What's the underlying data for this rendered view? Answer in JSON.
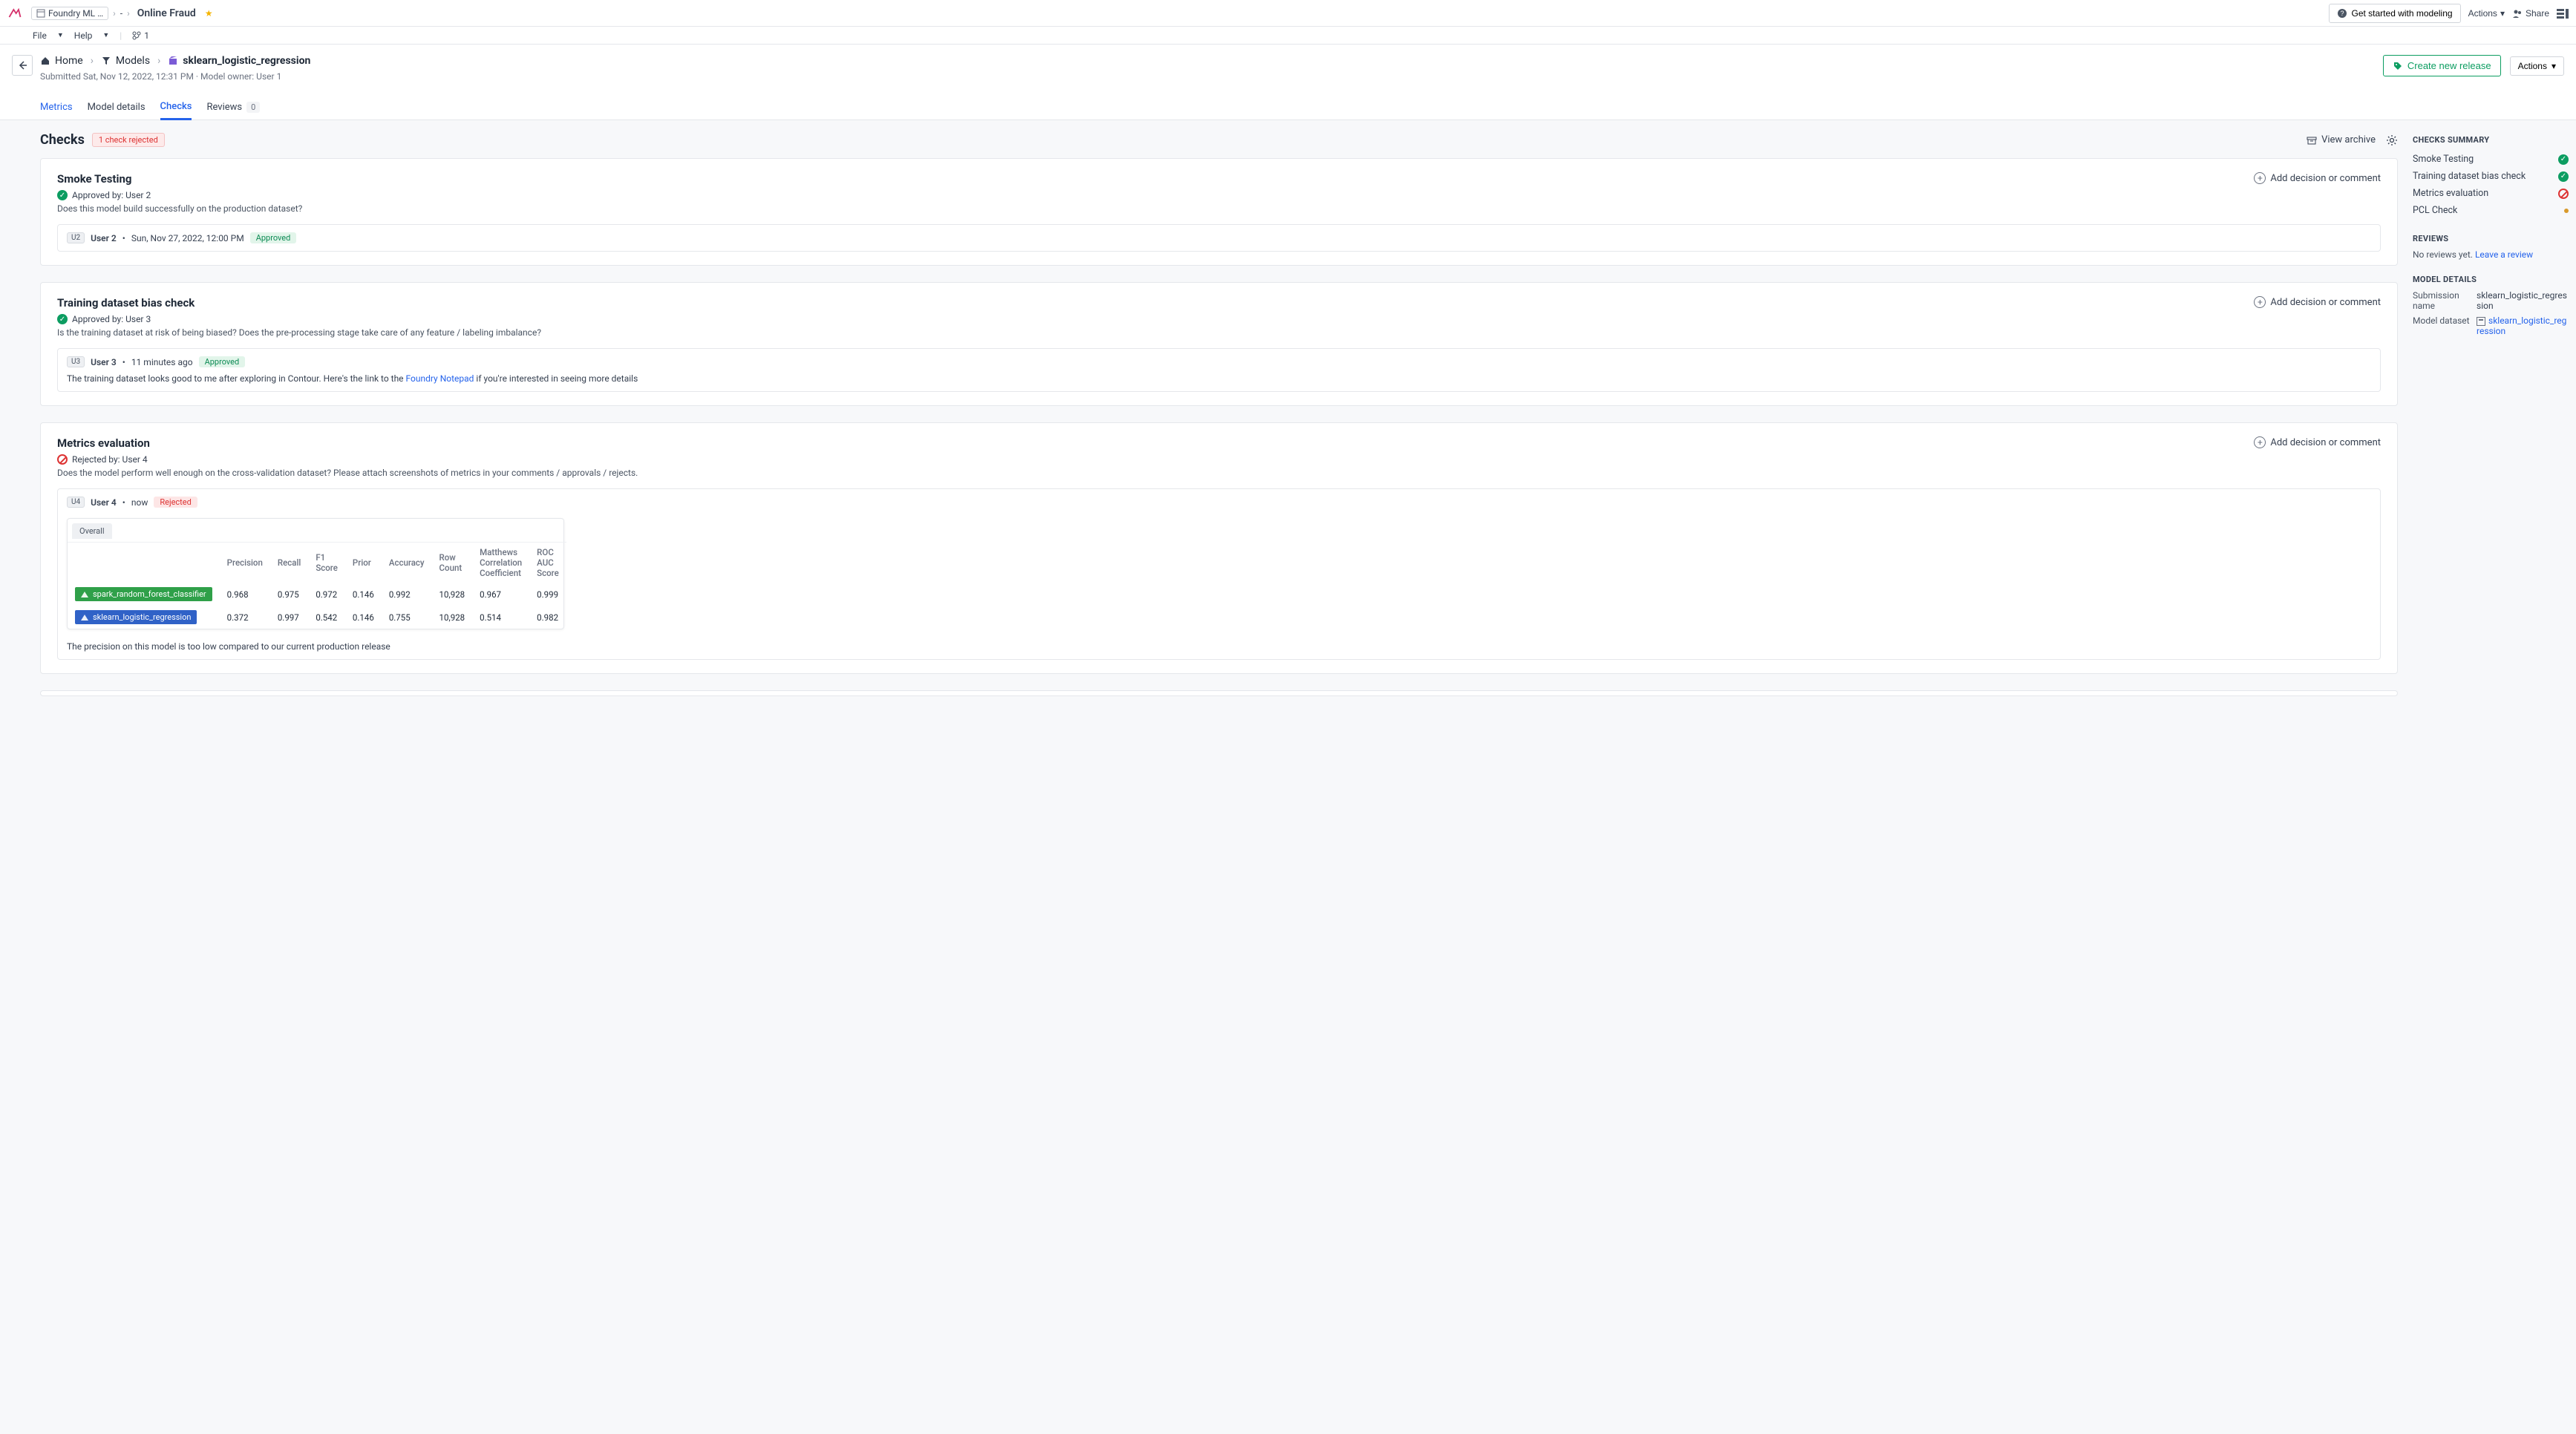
{
  "topbar": {
    "project": "Foundry ML …",
    "separator": "-",
    "title": "Online Fraud",
    "getStarted": "Get started with modeling",
    "actions": "Actions",
    "share": "Share"
  },
  "menubar": {
    "file": "File",
    "help": "Help",
    "branchCount": "1"
  },
  "breadcrumbs": {
    "home": "Home",
    "models": "Models",
    "current": "sklearn_logistic_regression"
  },
  "subline": "Submitted Sat, Nov 12, 2022, 12:31 PM · Model owner: User 1",
  "headerActions": {
    "createRelease": "Create new release",
    "actions": "Actions"
  },
  "tabs": {
    "metrics": "Metrics",
    "modelDetails": "Model details",
    "checks": "Checks",
    "reviews": "Reviews",
    "reviewsCount": "0"
  },
  "page": {
    "title": "Checks",
    "rejectBadge": "1 check rejected",
    "viewArchive": "View archive"
  },
  "checks": [
    {
      "title": "Smoke Testing",
      "status": "approved",
      "statusLine": "Approved by: User 2",
      "desc": "Does this model build successfully on the production dataset?",
      "addLabel": "Add decision or comment",
      "comment": {
        "avatar": "U2",
        "user": "User 2",
        "time": "Sun, Nov 27, 2022, 12:00 PM",
        "pill": "Approved",
        "pillClass": "approved"
      }
    },
    {
      "title": "Training dataset bias check",
      "status": "approved",
      "statusLine": "Approved by: User 3",
      "desc": "Is the training dataset at risk of being biased? Does the pre-processing stage take care of any feature / labeling imbalance?",
      "addLabel": "Add decision or comment",
      "comment": {
        "avatar": "U3",
        "user": "User 3",
        "time": "11 minutes ago",
        "pill": "Approved",
        "pillClass": "approved",
        "textPre": "The training dataset looks good to me after exploring in Contour. Here's the link to the ",
        "link": "Foundry Notepad",
        "textPost": " if you're interested in seeing more details"
      }
    },
    {
      "title": "Metrics evaluation",
      "status": "rejected",
      "statusLine": "Rejected by: User 4",
      "desc": "Does the model perform well enough on the cross-validation dataset? Please attach screenshots of metrics in your comments / approvals / rejects.",
      "addLabel": "Add decision or comment",
      "comment": {
        "avatar": "U4",
        "user": "User 4",
        "time": "now",
        "pill": "Rejected",
        "pillClass": "rejected",
        "footerText": "The precision on this model is too low compared to our current production release"
      },
      "metrics": {
        "tabLabel": "Overall",
        "headers": [
          "",
          "Precision",
          "Recall",
          "F1 Score",
          "Prior",
          "Accuracy",
          "Row Count",
          "Matthews Correlation Coefficient",
          "ROC AUC Score"
        ],
        "rows": [
          {
            "name": "spark_random_forest_classifier",
            "color": "green",
            "cells": [
              "0.968",
              "0.975",
              "0.972",
              "0.146",
              "0.992",
              "10,928",
              "0.967",
              "0.999"
            ]
          },
          {
            "name": "sklearn_logistic_regression",
            "color": "blue",
            "cells": [
              "0.372",
              "0.997",
              "0.542",
              "0.146",
              "0.755",
              "10,928",
              "0.514",
              "0.982"
            ]
          }
        ]
      }
    }
  ],
  "side": {
    "summaryTitle": "CHECKS SUMMARY",
    "summary": [
      {
        "label": "Smoke Testing",
        "state": "ok"
      },
      {
        "label": "Training dataset bias check",
        "state": "ok"
      },
      {
        "label": "Metrics evaluation",
        "state": "no"
      },
      {
        "label": "PCL Check",
        "state": "pending"
      }
    ],
    "reviewsTitle": "REVIEWS",
    "reviewsEmpty": "No reviews yet. ",
    "reviewsLink": "Leave a review",
    "detailsTitle": "MODEL DETAILS",
    "submissionKey": "Submission name",
    "submissionVal": "sklearn_logistic_regression",
    "datasetKey": "Model dataset",
    "datasetVal": "sklearn_logistic_regression"
  }
}
